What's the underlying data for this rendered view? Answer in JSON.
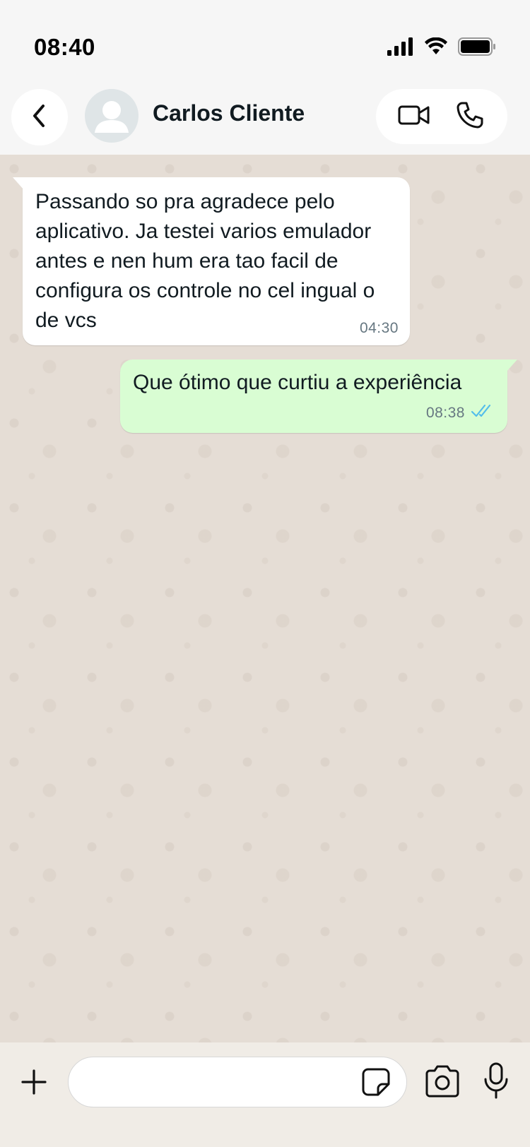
{
  "status_bar": {
    "time": "08:40"
  },
  "header": {
    "contact_name": "Carlos Cliente",
    "icons": [
      "back-arrow-icon",
      "avatar-placeholder",
      "video-call-icon",
      "phone-call-icon"
    ]
  },
  "messages": [
    {
      "direction": "incoming",
      "text": "Passando so pra agradece pelo aplicativo. Ja testei varios emulador antes e nen hum era tao facil de configura os controle no cel ingual o de vcs",
      "time": "04:30"
    },
    {
      "direction": "outgoing",
      "text": "Que ótimo que curtiu a experiência",
      "time": "08:38",
      "status": "read"
    }
  ],
  "input": {
    "placeholder": "",
    "value": "",
    "icons": [
      "plus-icon",
      "sticker-icon",
      "camera-icon",
      "microphone-icon"
    ]
  },
  "colors": {
    "incoming_bubble": "#ffffff",
    "outgoing_bubble": "#d9fdd3",
    "read_ticks": "#53bdeb",
    "chat_background": "#e5ddd5"
  }
}
